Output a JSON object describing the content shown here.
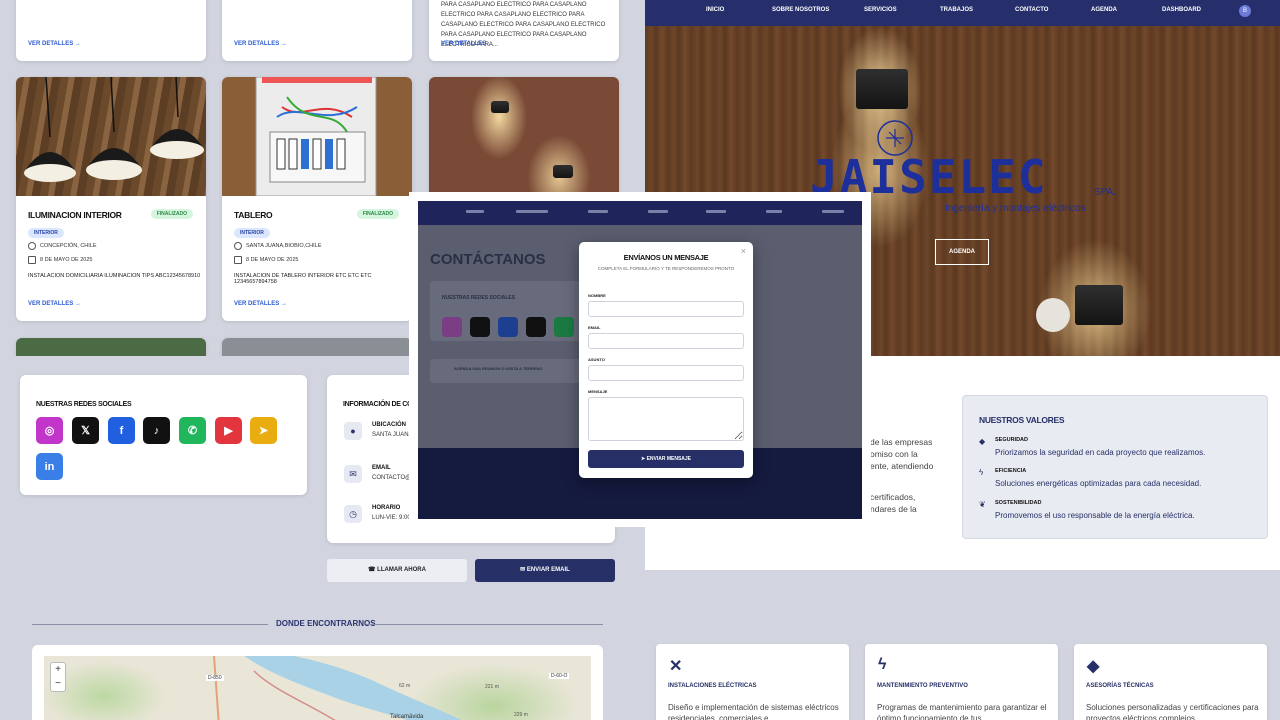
{
  "projects_panel": {
    "top_cards": [
      {
        "desc": "",
        "more": "VER DETALLES →"
      },
      {
        "desc": "",
        "more": "VER DETALLES →"
      },
      {
        "desc": "PARA CASAPLANO ELECTRICO PARA CASAPLANO ELECTRICO PARA CASAPLANO ELECTRICO PARA CASAPLANO ELECTRICO PARA CASAPLANO ELECTRICO PARA CASAPLANO ELECTRICO PARA CASAPLANO ELECTRICO PARA...",
        "more": "VER DETALLES →"
      }
    ],
    "cards": [
      {
        "title": "ILUMINACION INTERIOR",
        "status": "FINALIZADO",
        "tag": "INTERIOR",
        "location": "CONCEPCIÓN, CHILE",
        "date": "8 DE MAYO DE 2025",
        "desc": "INSTALACION DOMICILIARIA ILUMINACION TIPS ABC12345678910",
        "more": "VER DETALLES →"
      },
      {
        "title": "TABLERO",
        "status": "FINALIZADO",
        "tag": "INTERIOR",
        "location": "SANTA JUANA,BIOBIO,CHILE",
        "date": "8 DE MAYO DE 2025",
        "desc": "INSTALACION DE TABLERO INTERIOR ETC ETC ETC 12345657894758",
        "more": "VER DETALLES →"
      }
    ]
  },
  "hero": {
    "nav": [
      "INICIO",
      "SOBRE NOSOTROS",
      "SERVICIOS",
      "TRABAJOS",
      "CONTACTO",
      "AGENDA",
      "DASHBOARD"
    ],
    "avatar": "B",
    "brand": "JAISELEC",
    "brand_suffix": "SPA.",
    "tagline": "Ingeniería y montajes eléctricos",
    "cta": "AGENDA"
  },
  "contact": {
    "social_title": "NUESTRAS REDES SOCIALES",
    "social_icons": [
      {
        "name": "instagram",
        "color": "#c135c9"
      },
      {
        "name": "twitter",
        "color": "#111111"
      },
      {
        "name": "facebook",
        "color": "#1f5fe0"
      },
      {
        "name": "tiktok",
        "color": "#111111"
      },
      {
        "name": "whatsapp",
        "color": "#22b65c"
      },
      {
        "name": "youtube",
        "color": "#e3353d"
      },
      {
        "name": "telegram",
        "color": "#e9ad10"
      },
      {
        "name": "linkedin",
        "color": "#3a7ee8"
      }
    ],
    "info_title": "INFORMACIÓN DE CONT",
    "rows": [
      {
        "label": "UBICACIÓN",
        "value": "SANTA JUANA, C"
      },
      {
        "label": "EMAIL",
        "value": "CONTACTO@JAIS"
      },
      {
        "label": "HORARIO",
        "value": "LUN-VIE: 9:00 - 1"
      }
    ],
    "call_button": "LLAMAR AHORA",
    "email_button": "ENVIAR EMAIL",
    "map_title": "DONDE ENCONTRARNOS",
    "map_labels": [
      "D-850",
      "D-60-O",
      "Talcamávida",
      "62 m",
      "221 m",
      "229 m"
    ]
  },
  "about": {
    "lines": [
      "de las empresas",
      "omiso con la",
      "ente, atendiendo",
      "certificados,",
      "ndares de la"
    ]
  },
  "values": {
    "title": "NUESTROS VALORES",
    "items": [
      {
        "title": "SEGURIDAD",
        "desc": "Priorizamos la seguridad en cada proyecto que realizamos."
      },
      {
        "title": "EFICIENCIA",
        "desc": "Soluciones energéticas optimizadas para cada necesidad."
      },
      {
        "title": "SOSTENIBILIDAD",
        "desc": "Promovemos el uso responsable de la energía eléctrica."
      }
    ]
  },
  "services": [
    {
      "title": "INSTALACIONES ELÉCTRICAS",
      "desc": "Diseño e implementación de sistemas eléctricos residenciales, comerciales e"
    },
    {
      "title": "MANTENIMIENTO PREVENTIVO",
      "desc": "Programas de mantenimiento para garantizar el óptimo funcionamiento de tus"
    },
    {
      "title": "ASESORÍAS TÉCNICAS",
      "desc": "Soluciones personalizadas y certificaciones para proyectos eléctricos complejos"
    }
  ],
  "modal": {
    "background_title": "CONTÁCTANOS",
    "background_social": "NUESTRAS REDES SOCIALES",
    "background_schedule": "AGENDA UNA REUNIÓN O VISITA A TERRENO",
    "title": "ENVÍANOS UN MENSAJE",
    "subtitle": "COMPLETA EL FORMULARIO Y TE RESPONDEREMOS PRONTO",
    "fields": [
      "NOMBRE",
      "EMAIL",
      "ASUNTO",
      "MENSAJE"
    ],
    "submit": "ENVIAR MENSAJE",
    "close": "×"
  }
}
